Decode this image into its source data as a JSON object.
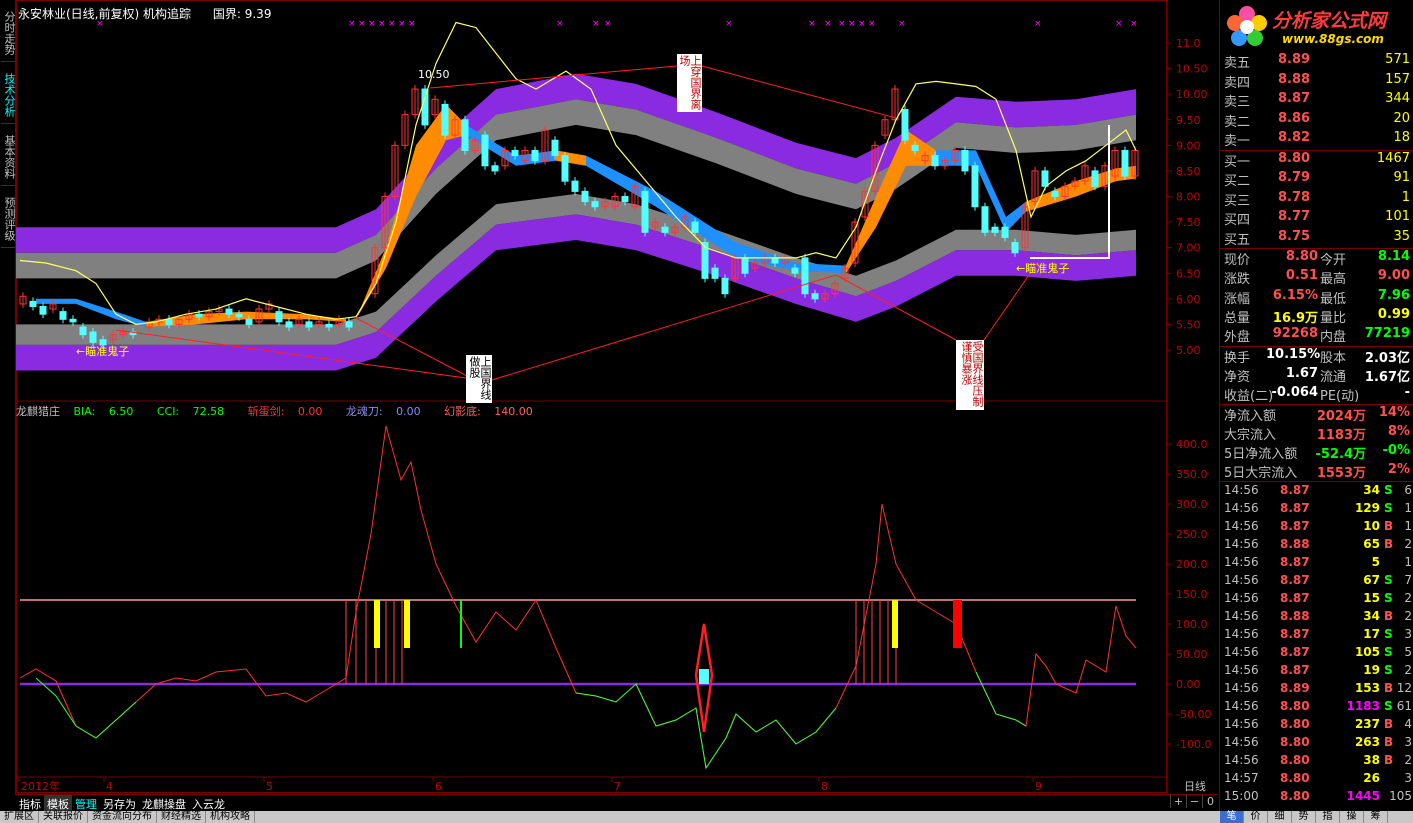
{
  "left_tabs": [
    "分时走势",
    "技术分析",
    "基本资料",
    "预测评级"
  ],
  "title": {
    "stock": "永安林业(日线,前复权)",
    "indicator": "机构追踪",
    "guojie_label": "国界:",
    "guojie_value": "9.39"
  },
  "price_axis": {
    "ticks": [
      "11.0",
      "10.50",
      "10.00",
      "9.50",
      "9.00",
      "8.50",
      "8.00",
      "7.50",
      "7.00",
      "6.50",
      "6.00",
      "5.50",
      "5.00"
    ]
  },
  "annotations": {
    "high_price": "10.50",
    "box_up_cross": "上穿国界离场",
    "box_up_guojie": "上国界线做股",
    "box_down_guojie": "受国界线压制谨慎暴涨",
    "aim_ghost": "←瞄准鬼子"
  },
  "indicator": {
    "name": "龙麒猎庄",
    "bia_label": "BIA:",
    "bia_value": "6.50",
    "cci_label": "CCI:",
    "cci_value": "72.58",
    "sword_label": "斩蛋剑:",
    "sword_value": "0.00",
    "knife_label": "龙魂刀:",
    "knife_value": "0.00",
    "shadow_label": "幻影底:",
    "shadow_value": "140.00",
    "axis_ticks": [
      "400.0",
      "350.0",
      "300.0",
      "250.0",
      "200.0",
      "150.0",
      "100.0",
      "50.00",
      "0.00",
      "-50.00",
      "-100.0"
    ]
  },
  "time_axis": {
    "labels": [
      "2012年",
      "4",
      "5",
      "6",
      "7",
      "8",
      "9"
    ],
    "period": "日线"
  },
  "bottom_tabs": [
    "指标",
    "模板",
    "管理",
    "另存为",
    "龙麒操盘",
    "入云龙"
  ],
  "bottom_ctrl": [
    "+",
    "−",
    "0"
  ],
  "status_strip": [
    "扩展区",
    "关联报价",
    "资金流向分布",
    "财经精选",
    "机构攻略"
  ],
  "logo": {
    "text": "分析家公式网",
    "url": "www.88gs.com"
  },
  "order_book": {
    "asks": [
      {
        "label": "卖五",
        "price": "8.89",
        "vol": "571"
      },
      {
        "label": "卖四",
        "price": "8.88",
        "vol": "157"
      },
      {
        "label": "卖三",
        "price": "8.87",
        "vol": "344"
      },
      {
        "label": "卖二",
        "price": "8.86",
        "vol": "20"
      },
      {
        "label": "卖一",
        "price": "8.82",
        "vol": "18"
      }
    ],
    "bids": [
      {
        "label": "买一",
        "price": "8.80",
        "vol": "1467"
      },
      {
        "label": "买二",
        "price": "8.79",
        "vol": "91"
      },
      {
        "label": "买三",
        "price": "8.78",
        "vol": "1"
      },
      {
        "label": "买四",
        "price": "8.77",
        "vol": "101"
      },
      {
        "label": "买五",
        "price": "8.75",
        "vol": "35"
      }
    ]
  },
  "quote": [
    {
      "l1": "现价",
      "v1": "8.80",
      "c1": "red",
      "l2": "今开",
      "v2": "8.14",
      "c2": "green"
    },
    {
      "l1": "涨跌",
      "v1": "0.51",
      "c1": "red",
      "l2": "最高",
      "v2": "9.00",
      "c2": "red"
    },
    {
      "l1": "涨幅",
      "v1": "6.15%",
      "c1": "red",
      "l2": "最低",
      "v2": "7.96",
      "c2": "green"
    },
    {
      "l1": "总量",
      "v1": "16.9万",
      "c1": "yellow",
      "l2": "量比",
      "v2": "0.99",
      "c2": "yellow"
    },
    {
      "l1": "外盘",
      "v1": "92268",
      "c1": "red",
      "l2": "内盘",
      "v2": "77219",
      "c2": "green"
    },
    {
      "l1": "换手",
      "v1": "10.15%",
      "c1": "white",
      "l2": "股本",
      "v2": "2.03亿",
      "c2": "white"
    },
    {
      "l1": "净资",
      "v1": "1.67",
      "c1": "white",
      "l2": "流通",
      "v2": "1.67亿",
      "c2": "white"
    },
    {
      "l1": "收益(二)",
      "v1": "-0.064",
      "c1": "white",
      "l2": "PE(动)",
      "v2": "-",
      "c2": "white"
    }
  ],
  "flows": [
    {
      "label": "净流入额",
      "value": "2024万",
      "pct": "14%",
      "color": "red"
    },
    {
      "label": "大宗流入",
      "value": "1183万",
      "pct": "8%",
      "color": "red"
    },
    {
      "label": "5日净流入额",
      "value": "-52.4万",
      "pct": "-0%",
      "color": "green"
    },
    {
      "label": "5日大宗流入",
      "value": "1553万",
      "pct": "2%",
      "color": "red"
    }
  ],
  "ticks": [
    {
      "time": "14:56",
      "price": "8.87",
      "vol": "34",
      "bs": "S",
      "n": "6"
    },
    {
      "time": "14:56",
      "price": "8.87",
      "vol": "129",
      "bs": "S",
      "n": "1"
    },
    {
      "time": "14:56",
      "price": "8.87",
      "vol": "10",
      "bs": "B",
      "n": "1"
    },
    {
      "time": "14:56",
      "price": "8.88",
      "vol": "65",
      "bs": "B",
      "n": "2"
    },
    {
      "time": "14:56",
      "price": "8.87",
      "vol": "5",
      "bs": "",
      "n": "1"
    },
    {
      "time": "14:56",
      "price": "8.87",
      "vol": "67",
      "bs": "S",
      "n": "7"
    },
    {
      "time": "14:56",
      "price": "8.87",
      "vol": "15",
      "bs": "S",
      "n": "2"
    },
    {
      "time": "14:56",
      "price": "8.88",
      "vol": "34",
      "bs": "B",
      "n": "2"
    },
    {
      "time": "14:56",
      "price": "8.87",
      "vol": "17",
      "bs": "S",
      "n": "3"
    },
    {
      "time": "14:56",
      "price": "8.87",
      "vol": "105",
      "bs": "S",
      "n": "5"
    },
    {
      "time": "14:56",
      "price": "8.87",
      "vol": "19",
      "bs": "S",
      "n": "2"
    },
    {
      "time": "14:56",
      "price": "8.89",
      "vol": "153",
      "bs": "B",
      "n": "12"
    },
    {
      "time": "14:56",
      "price": "8.80",
      "vol": "1183",
      "bs": "S",
      "n": "61"
    },
    {
      "time": "14:56",
      "price": "8.80",
      "vol": "237",
      "bs": "B",
      "n": "4"
    },
    {
      "time": "14:56",
      "price": "8.80",
      "vol": "263",
      "bs": "B",
      "n": "3"
    },
    {
      "time": "14:56",
      "price": "8.80",
      "vol": "38",
      "bs": "B",
      "n": "2"
    },
    {
      "time": "14:57",
      "price": "8.80",
      "vol": "26",
      "bs": "",
      "n": "3"
    },
    {
      "time": "15:00",
      "price": "8.80",
      "vol": "1445",
      "bs": "",
      "n": "105"
    }
  ],
  "rp_bottom": [
    "笔",
    "价",
    "细",
    "势",
    "指",
    "操",
    "筹"
  ],
  "colors": {
    "band_outer": "#8a2be2",
    "band_inner": "#808080",
    "up_ribbon": "#ff8c00",
    "down_ribbon": "#1e90ff",
    "kline_up": "#ff3333",
    "kline_down": "#54ffff",
    "price_line": "#ffff66",
    "grid_red": "#7a0000"
  }
}
